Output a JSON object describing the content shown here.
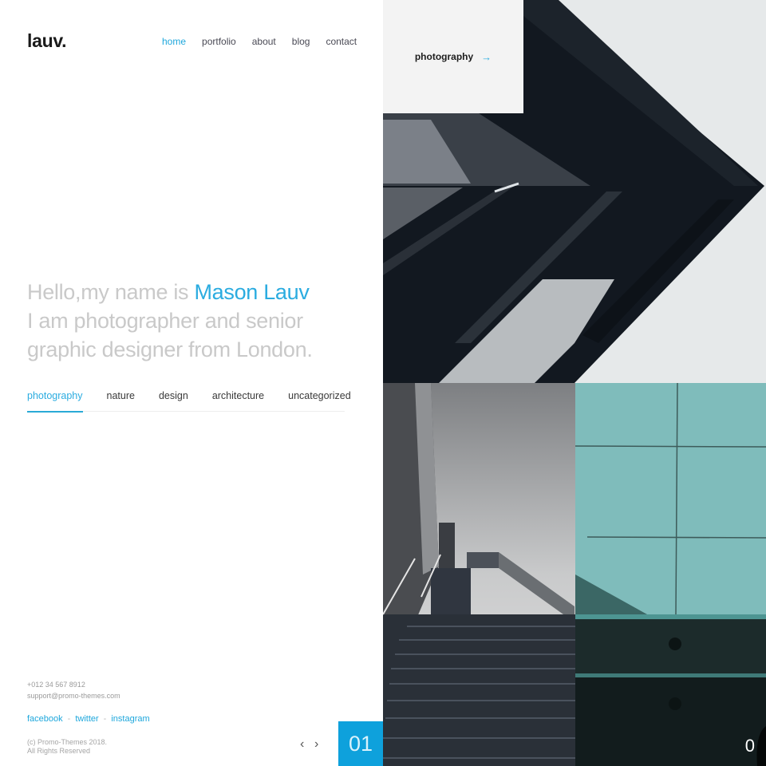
{
  "brand": {
    "logo": "lauv."
  },
  "nav": {
    "items": [
      {
        "label": "home",
        "active": true
      },
      {
        "label": "portfolio",
        "active": false
      },
      {
        "label": "about",
        "active": false
      },
      {
        "label": "blog",
        "active": false
      },
      {
        "label": "contact",
        "active": false
      }
    ]
  },
  "hero": {
    "intro": "Hello,my name is ",
    "name": "Mason Lauv",
    "line2": "I am photographer and senior",
    "line3": "graphic designer from London."
  },
  "categories": {
    "items": [
      {
        "label": "photography",
        "active": true
      },
      {
        "label": "nature",
        "active": false
      },
      {
        "label": "design",
        "active": false
      },
      {
        "label": "architecture",
        "active": false
      },
      {
        "label": "uncategorized",
        "active": false
      }
    ]
  },
  "contact": {
    "phone": "+012 34 567 8912",
    "email": "support@promo-themes.com"
  },
  "social": {
    "links": [
      "facebook",
      "twitter",
      "instagram"
    ],
    "separator": "-"
  },
  "footer": {
    "copyright_line1": "(c) Promo-Themes 2018.",
    "copyright_line2": "All Rights Reserved"
  },
  "slider": {
    "prev_icon": "‹",
    "next_icon": "›",
    "current": "01",
    "next_partial": "0"
  },
  "gallery": {
    "category_card": {
      "label": "photography",
      "arrow": "→"
    },
    "tiles": [
      {
        "subject": "black chevron facade architecture"
      },
      {
        "subject": "outdoor concrete staircase under cloudy sky"
      },
      {
        "subject": "teal tiled wall with dark rail"
      }
    ]
  },
  "colors": {
    "accent": "#1ea7dc",
    "counter_bg": "#0ea1dc",
    "card_bg": "#f3f3f3",
    "hero_text": "#c9c9c9"
  }
}
